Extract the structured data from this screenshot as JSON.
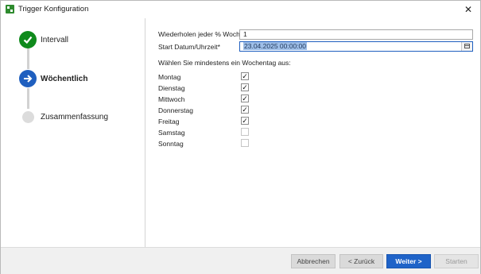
{
  "window": {
    "title": "Trigger Konfiguration",
    "close_symbol": "✕"
  },
  "steps": [
    {
      "label": "Intervall",
      "state": "done"
    },
    {
      "label": "Wöchentlich",
      "state": "active"
    },
    {
      "label": "Zusammenfassung",
      "state": "pending"
    }
  ],
  "form": {
    "repeat_label": "Wiederholen jeder % Woche*",
    "repeat_value": "1",
    "start_label": "Start Datum/Uhrzeit*",
    "start_value": "23.04.2025 00:00:00",
    "weekday_prompt": "Wählen Sie mindestens ein Wochentag aus:"
  },
  "weekdays": [
    {
      "label": "Montag",
      "checked": true
    },
    {
      "label": "Dienstag",
      "checked": true
    },
    {
      "label": "Mittwoch",
      "checked": true
    },
    {
      "label": "Donnerstag",
      "checked": true
    },
    {
      "label": "Freitag",
      "checked": true
    },
    {
      "label": "Samstag",
      "checked": false
    },
    {
      "label": "Sonntag",
      "checked": false
    }
  ],
  "footer": {
    "cancel": "Abbrechen",
    "back": "< Zurück",
    "next": "Weiter >",
    "start": "Starten"
  },
  "icons": {
    "done": "check-icon",
    "active": "arrow-right-icon",
    "calendar": "calendar-icon"
  }
}
